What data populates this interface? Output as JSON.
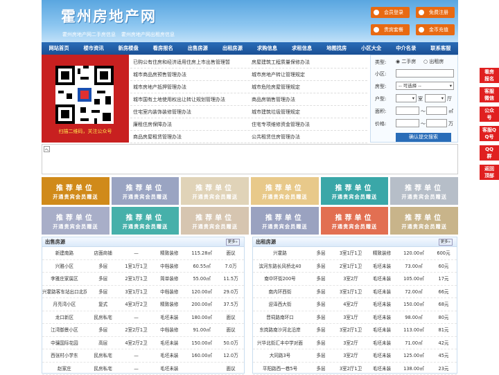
{
  "header": {
    "title": "霍州房地产网",
    "subtitles": [
      "霍州房地产网二手房信息",
      "霍州房地产网出租房信息"
    ],
    "buttons": {
      "login": "会员登录",
      "register": "免费注册",
      "package": "贵宾套餐",
      "recharge": "金币充值"
    }
  },
  "nav": [
    "网站首页",
    "楼市资讯",
    "新房楼盘",
    "看房报名",
    "出售房源",
    "出租房源",
    "求购信息",
    "求租信息",
    "地图找房",
    "小区大全",
    "中介名录",
    "联系客服"
  ],
  "qr": {
    "caption": "扫描二维码，关注公众号"
  },
  "links": [
    [
      "已购公有住房和经济适用住房上市出售管理暂",
      "房屋建筑工程质量保修办法"
    ],
    [
      "城市商品房预售管理办法",
      "城市房地产转让管理规定"
    ],
    [
      "城市房地产抵押管理办法",
      "城市危险房屋管理规定"
    ],
    [
      "城市国有土地使用权出让转让规划管理办法",
      "商品房销售管理办法"
    ],
    [
      "住宅室内装饰装修管理办法",
      "城市建筑垃圾管理规定"
    ],
    [
      "廉租住房保障办法",
      "住宅专项维修资金管理办法"
    ],
    [
      "商品房屋租赁管理办法",
      "公共租赁住房管理办法"
    ]
  ],
  "search": {
    "type_label": "类型:",
    "opt_sale": "二手房",
    "opt_rent": "出租房",
    "community_label": "小区:",
    "housetype_label": "房型:",
    "select_placeholder": "-- 可选择 --",
    "layout_label": "户型:",
    "room_unit": "室",
    "hall_unit": "厅",
    "area_label": "面积:",
    "area_unit": "㎡",
    "price_label": "价格:",
    "price_unit": "万",
    "submit": "确认提交搜索",
    "to": "～"
  },
  "ads": {
    "line1": "推荐单位",
    "line2": "开通贵宾会员赠送",
    "colors": [
      "#d08a1a",
      "#9aa4c2",
      "#e0d3b8",
      "#e8c98a",
      "#3aa7a8",
      "#b6bec8",
      "#a8aec8",
      "#46b0aa",
      "#d6c5b0",
      "#9aa2c0",
      "#e26f52",
      "#c8b48a"
    ]
  },
  "sale": {
    "title": "出售房源",
    "more": "更多»",
    "rows": [
      [
        "新建南路",
        "店面商铺",
        "—",
        "精致装修",
        "115.28㎡",
        "面议"
      ],
      [
        "兴雅小区",
        "多层",
        "1室1厅1卫",
        "中档装修",
        "60.55㎡",
        "7.0万"
      ],
      [
        "李雅庄家属区",
        "多层",
        "2室1厅1卫",
        "简单装修",
        "55.00㎡",
        "11.5万"
      ],
      [
        "兴霍路客车站出口北拐角",
        "多层",
        "3室1厅1卫",
        "中档装修",
        "120.00㎡",
        "29.0万"
      ],
      [
        "月亮湾小区",
        "复式",
        "4室3厅2卫",
        "精致装修",
        "200.00㎡",
        "37.5万"
      ],
      [
        "龙口新区",
        "民房私宅",
        "—",
        "毛坯未装",
        "180.00㎡",
        "面议"
      ],
      [
        "江湾御景小区",
        "多层",
        "2室2厅1卫",
        "中档装修",
        "91.00㎡",
        "面议"
      ],
      [
        "中骧国际花园",
        "高层",
        "4室2厅2卫",
        "毛坯未装",
        "150.00㎡",
        "50.0万"
      ],
      [
        "西张村小学东",
        "民房私宅",
        "—",
        "毛坯未装",
        "160.00㎡",
        "12.0万"
      ],
      [
        "赵家庄",
        "民房私宅",
        "—",
        "毛坯未装",
        "",
        "面议"
      ]
    ]
  },
  "rent": {
    "title": "出租房源",
    "more": "更多»",
    "rows": [
      [
        "兴霍路",
        "多层",
        "3室1厅1卫",
        "精致装修",
        "120.00㎡",
        "600元"
      ],
      [
        "滨河东路长风桥北40",
        "多层",
        "2室1厅1卫",
        "毛坯未装",
        "73.00㎡",
        "60元"
      ],
      [
        "南中环街200号",
        "多层",
        "3室2厅",
        "毛坯未装",
        "105.00㎡",
        "17元"
      ],
      [
        "南内环西街",
        "多层",
        "3室1厅1卫",
        "毛坯未装",
        "72.00㎡",
        "66元"
      ],
      [
        "迎泽西大街",
        "多层",
        "4室2厅",
        "毛坯未装",
        "150.00㎡",
        "68元"
      ],
      [
        "晋祠路南环口",
        "多层",
        "3室1厅",
        "毛坯未装",
        "98.00㎡",
        "80元"
      ],
      [
        "东岗路南沙河北沿岸",
        "多层",
        "3室2厅1卫",
        "毛坯未装",
        "113.00㎡",
        "81元"
      ],
      [
        "兴华北街汇丰中学对面",
        "多层",
        "3室2厅",
        "毛坯未装",
        "71.00㎡",
        "42元"
      ],
      [
        "大同路3号",
        "多层",
        "3室2厅",
        "毛坯未装",
        "125.00㎡",
        "45元"
      ],
      [
        "平阳路西一巷5号",
        "多层",
        "3室2厅1卫",
        "毛坯未装",
        "138.00㎡",
        "23元"
      ]
    ]
  },
  "side": [
    "看房报名",
    "客服微信",
    "公众号",
    "客服QQ号",
    "QQ群",
    "返回顶部"
  ]
}
